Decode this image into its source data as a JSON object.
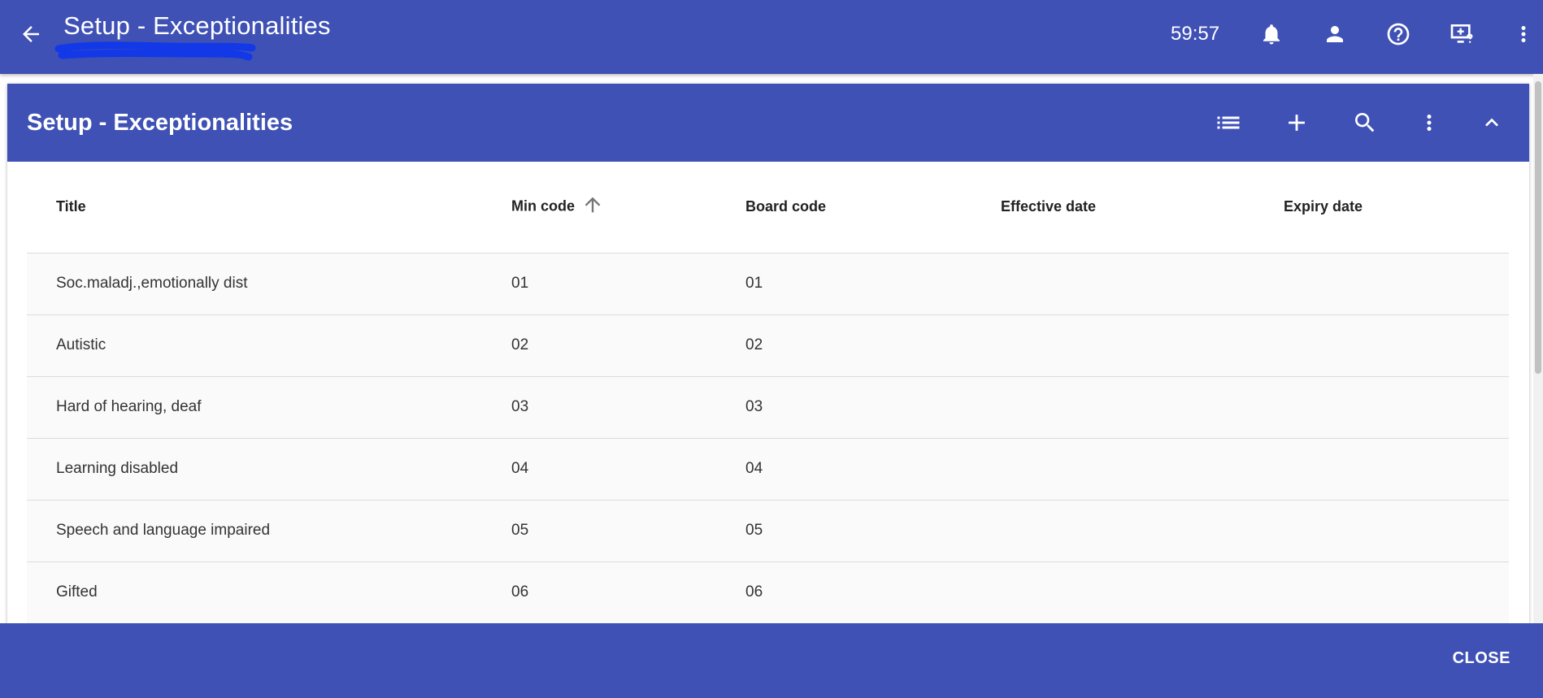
{
  "topbar": {
    "title": "Setup - Exceptionalities",
    "timer": "59:57",
    "icons": [
      "back-arrow-icon",
      "bell-icon",
      "person-icon",
      "help-icon",
      "screen-help-icon",
      "more-vert-icon"
    ]
  },
  "card": {
    "title": "Setup - Exceptionalities",
    "icons": [
      "list-icon",
      "add-icon",
      "search-icon",
      "more-vert-icon",
      "chevron-up-icon"
    ]
  },
  "table": {
    "columns": [
      "Title",
      "Min code",
      "Board code",
      "Effective date",
      "Expiry date"
    ],
    "sorted_column": "Min code",
    "sort_direction": "ascending",
    "rows": [
      [
        "Soc.maladj.,emotionally dist",
        "01",
        "01",
        "",
        ""
      ],
      [
        "Autistic",
        "02",
        "02",
        "",
        ""
      ],
      [
        "Hard of hearing, deaf",
        "03",
        "03",
        "",
        ""
      ],
      [
        "Learning disabled",
        "04",
        "04",
        "",
        ""
      ],
      [
        "Speech and language impaired",
        "05",
        "05",
        "",
        ""
      ],
      [
        "Gifted",
        "06",
        "06",
        "",
        ""
      ]
    ]
  },
  "footer": {
    "close_label": "CLOSE"
  },
  "colors": {
    "primary": "#3f51b5",
    "row_bg": "#fafafa",
    "divider": "#dcdcdc"
  }
}
